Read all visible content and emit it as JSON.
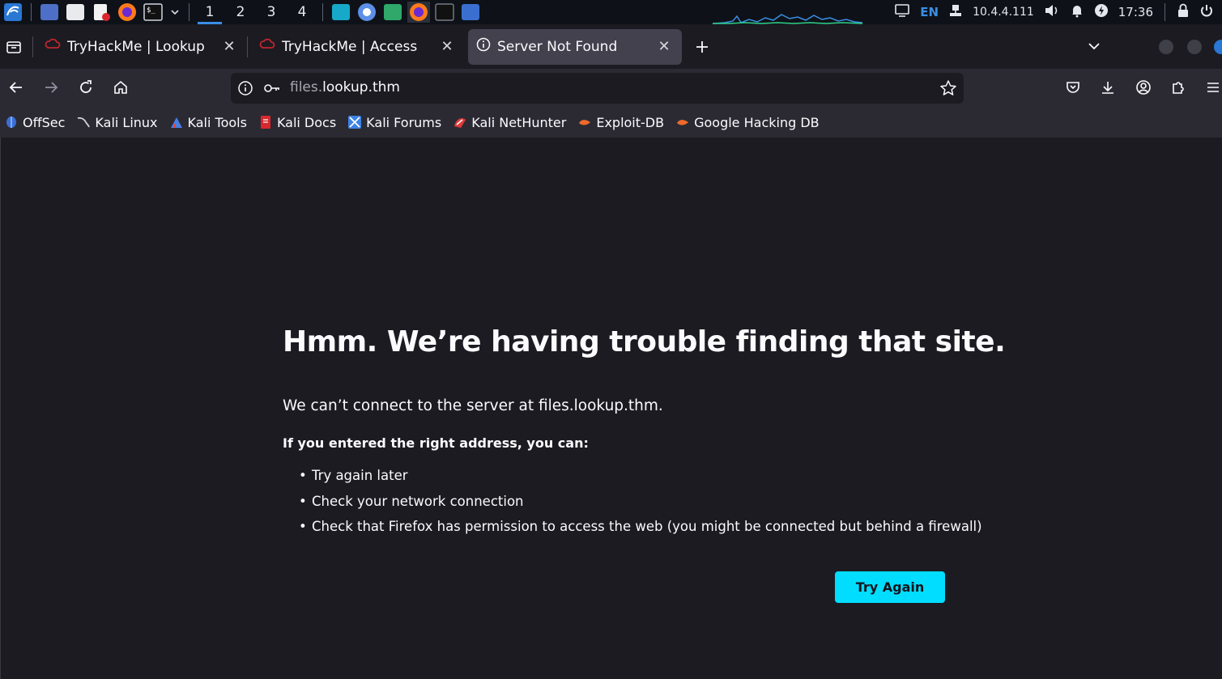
{
  "panel": {
    "workspaces": [
      "1",
      "2",
      "3",
      "4"
    ],
    "active_workspace": "1",
    "language": "EN",
    "ip_address": "10.4.4.111",
    "clock": "17:36"
  },
  "tabs": [
    {
      "label": "TryHackMe | Lookup",
      "icon": "tryhackme-icon",
      "selected": false
    },
    {
      "label": "TryHackMe | Access",
      "icon": "tryhackme-icon",
      "selected": false
    },
    {
      "label": "Server Not Found",
      "icon": "info-icon",
      "selected": true
    }
  ],
  "urlbar": {
    "url_dim": "files.",
    "url_main": "lookup.thm"
  },
  "bookmarks": [
    {
      "label": "OffSec",
      "icon": "offsec-icon",
      "color": "#3b6fd6"
    },
    {
      "label": "Kali Linux",
      "icon": "kali-dragon-icon",
      "color": "#cfd4dc"
    },
    {
      "label": "Kali Tools",
      "icon": "kali-tools-icon",
      "color": "#4a7fe0"
    },
    {
      "label": "Kali Docs",
      "icon": "kali-docs-icon",
      "color": "#d8282e"
    },
    {
      "label": "Kali Forums",
      "icon": "kali-forums-icon",
      "color": "#3d82e6"
    },
    {
      "label": "Kali NetHunter",
      "icon": "nethunter-icon",
      "color": "#e03a3a"
    },
    {
      "label": "Exploit-DB",
      "icon": "exploit-db-icon",
      "color": "#ef6a2a"
    },
    {
      "label": "Google Hacking DB",
      "icon": "ghdb-icon",
      "color": "#ef6a2a"
    }
  ],
  "error_page": {
    "title": "Hmm. We’re having trouble finding that site.",
    "description": "We can’t connect to the server at files.lookup.thm.",
    "subheading": "If you entered the right address, you can:",
    "suggestions": [
      "Try again later",
      "Check your network connection",
      "Check that Firefox has permission to access the web (you might be connected but behind a firewall)"
    ],
    "button_label": "Try Again",
    "button_color": "#00ddff"
  }
}
